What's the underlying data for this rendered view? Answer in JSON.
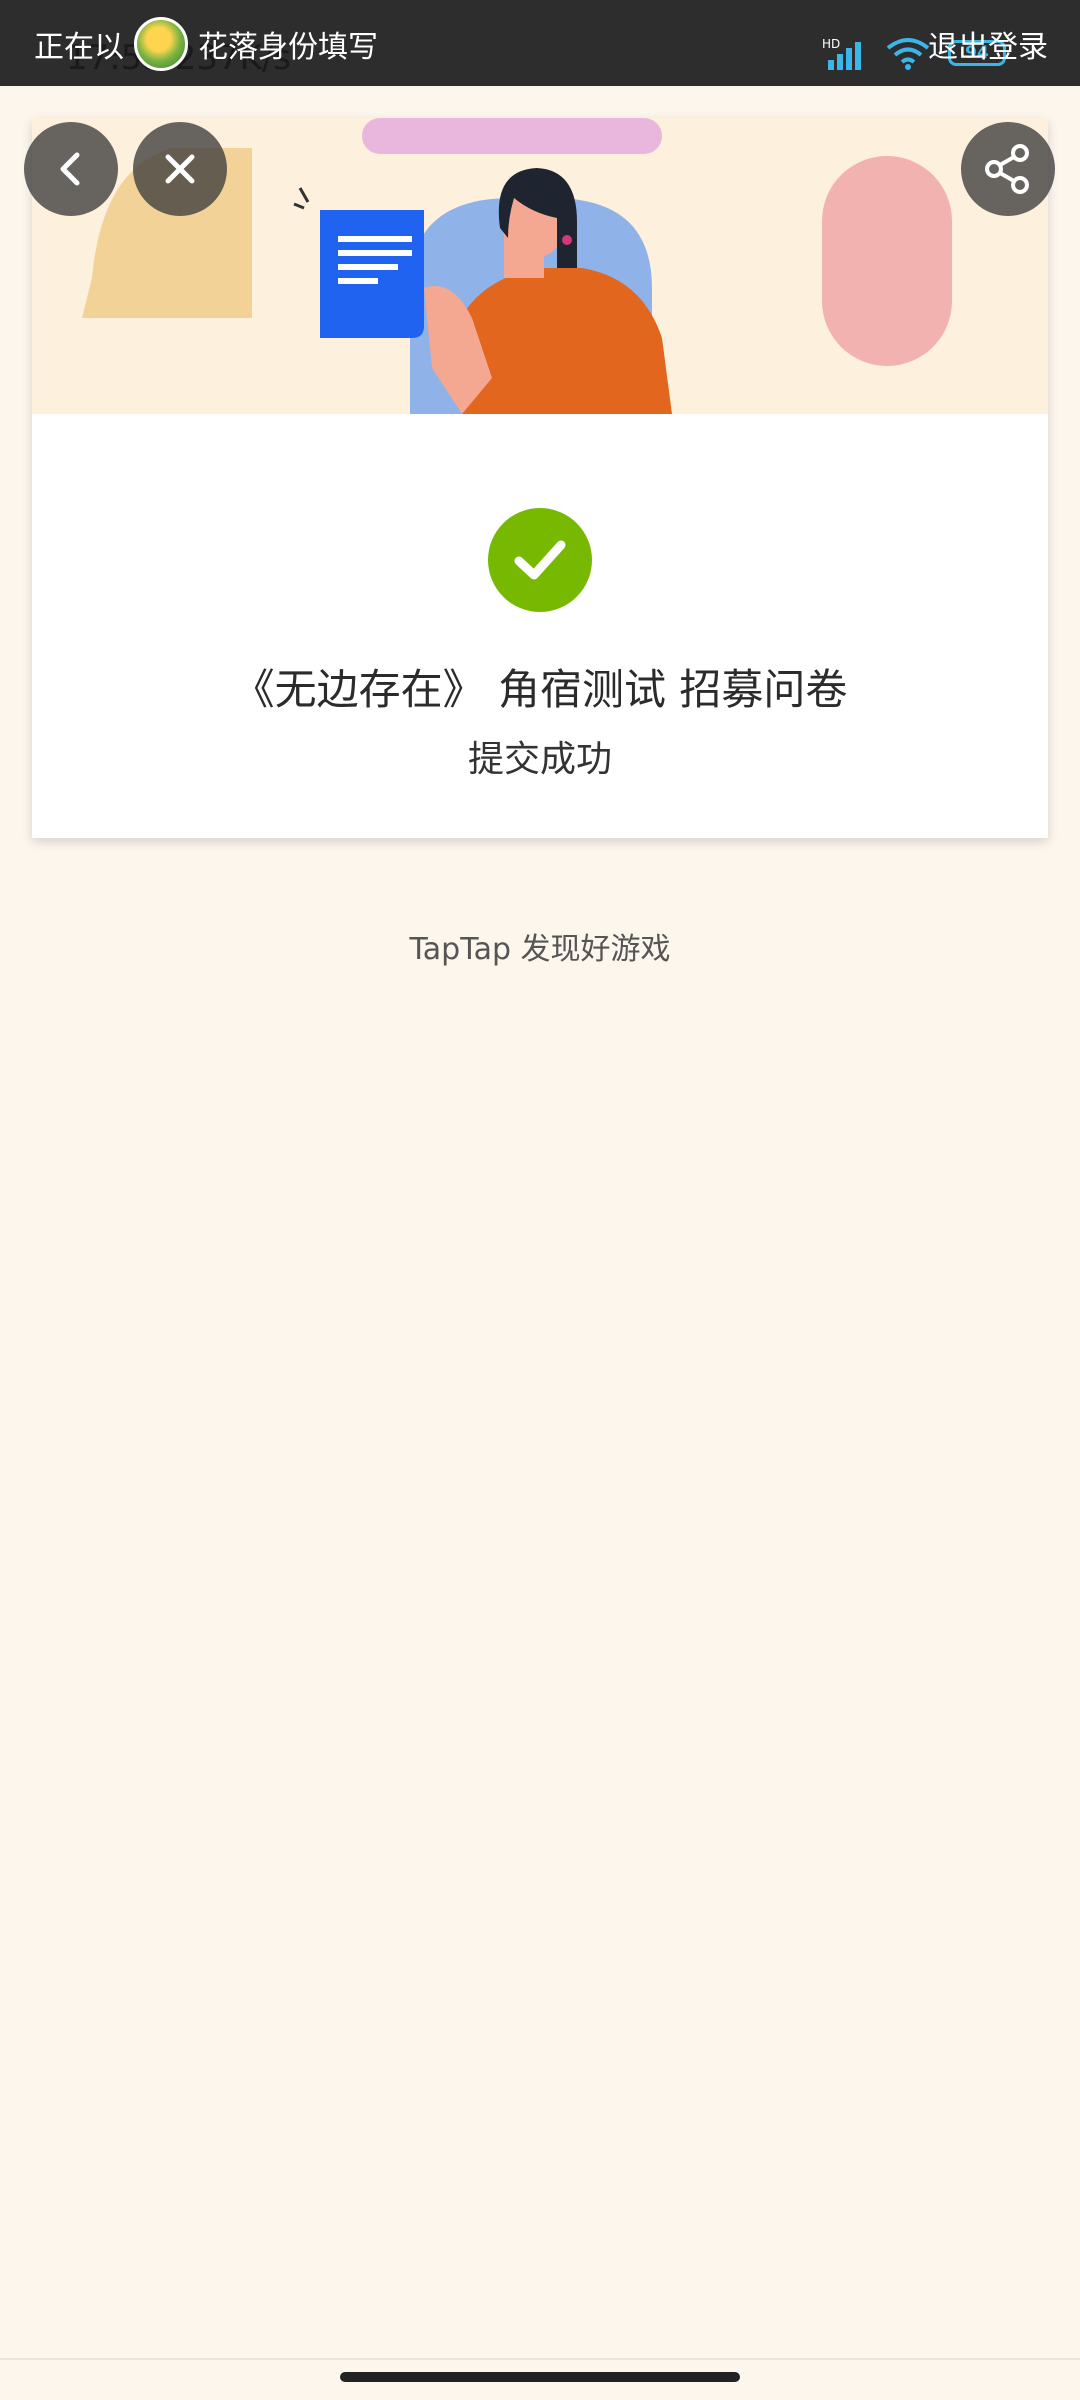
{
  "top_bar": {
    "login_prefix": "正在以",
    "user_name": "花落",
    "login_suffix": "身份填写",
    "logout_label": "退出登录",
    "status_time": "17:53 237K/s",
    "battery_level": "94",
    "signal_label": "HD"
  },
  "card": {
    "survey_title": "《无边存在》 角宿测试 招募问卷",
    "submit_status": "提交成功"
  },
  "footer": {
    "slogan": "TapTap 发现好游戏"
  },
  "colors": {
    "success_green": "#76b900",
    "page_background": "#fdf6ed",
    "banner_background": "#fdf0dc"
  },
  "icons": {
    "back": "chevron-left-icon",
    "close": "close-icon",
    "share": "share-icon",
    "success": "checkmark-icon"
  }
}
